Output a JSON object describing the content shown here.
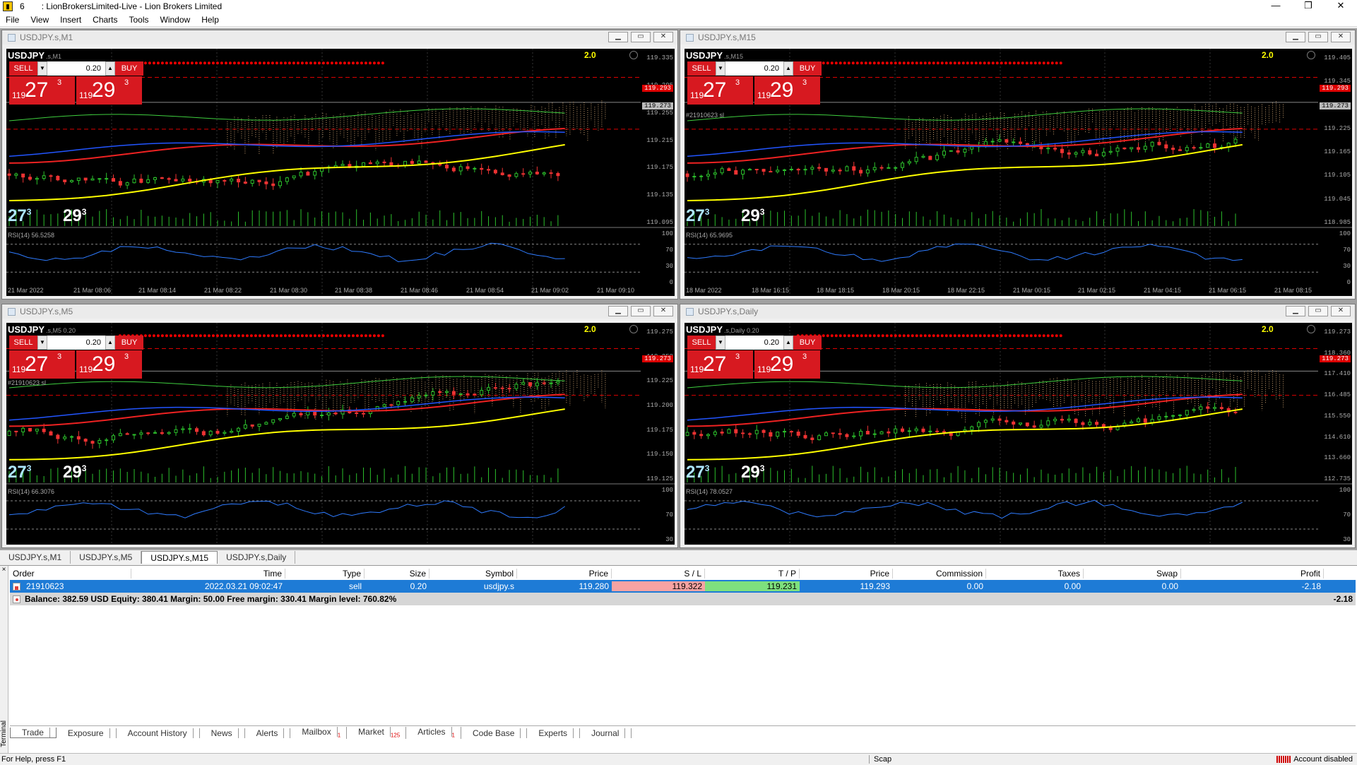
{
  "window": {
    "number": "6",
    "title": ": LionBrokersLimited-Live - Lion Brokers Limited",
    "controls": [
      "—",
      "❐",
      "✕"
    ]
  },
  "menu": [
    "File",
    "View",
    "Insert",
    "Charts",
    "Tools",
    "Window",
    "Help"
  ],
  "charts": [
    {
      "id": "m1",
      "title": "USDJPY.s,M1",
      "symbol": "USDJPY",
      "symbol_suffix": ".s,M1",
      "version": "2.0",
      "sell_label": "SELL",
      "buy_label": "BUY",
      "lot": "0.20",
      "sell_prefix": "119",
      "sell_big": "27",
      "sell_sup": "3",
      "buy_prefix": "119",
      "buy_big": "29",
      "buy_sup": "3",
      "spread_left": "27",
      "spread_left_sup": "3",
      "spread_right": "29",
      "spread_right_sup": "3",
      "price_labels": [
        "119.335",
        "119.295",
        "119.255",
        "119.215",
        "119.175",
        "119.135",
        "119.095"
      ],
      "price_tags": [
        "119.293",
        "119.273"
      ],
      "rsi_label": "RSI(14) 56.5258",
      "rsi_levels": [
        "100",
        "70",
        "30",
        "0"
      ],
      "time_labels": [
        "21 Mar 2022",
        "21 Mar 08:06",
        "21 Mar 08:14",
        "21 Mar 08:22",
        "21 Mar 08:30",
        "21 Mar 08:38",
        "21 Mar 08:46",
        "21 Mar 08:54",
        "21 Mar 09:02",
        "21 Mar 09:10"
      ]
    },
    {
      "id": "m15",
      "title": "USDJPY.s,M15",
      "symbol": "USDJPY",
      "symbol_suffix": ".s,M15",
      "version": "2.0",
      "sell_label": "SELL",
      "buy_label": "BUY",
      "lot": "0.20",
      "sell_prefix": "119",
      "sell_big": "27",
      "sell_sup": "3",
      "buy_prefix": "119",
      "buy_big": "29",
      "buy_sup": "3",
      "spread_left": "27",
      "spread_left_sup": "3",
      "spread_right": "29",
      "spread_right_sup": "3",
      "order_label": "#21910623 sl",
      "price_labels": [
        "119.405",
        "119.345",
        "119.285",
        "119.225",
        "119.165",
        "119.105",
        "119.045",
        "118.985"
      ],
      "price_tags": [
        "119.293",
        "119.273"
      ],
      "rsi_label": "RSI(14) 65.9695",
      "rsi_levels": [
        "100",
        "70",
        "30",
        "0"
      ],
      "time_labels": [
        "18 Mar 2022",
        "18 Mar 16:15",
        "18 Mar 18:15",
        "18 Mar 20:15",
        "18 Mar 22:15",
        "21 Mar 00:15",
        "21 Mar 02:15",
        "21 Mar 04:15",
        "21 Mar 06:15",
        "21 Mar 08:15"
      ]
    },
    {
      "id": "m5",
      "title": "USDJPY.s,M5",
      "symbol": "USDJPY",
      "symbol_suffix": ".s,M5 0.20",
      "version": "2.0",
      "sell_label": "SELL",
      "buy_label": "BUY",
      "lot": "0.20",
      "sell_prefix": "119",
      "sell_big": "27",
      "sell_sup": "3",
      "buy_prefix": "119",
      "buy_big": "29",
      "buy_sup": "3",
      "spread_left": "27",
      "spread_left_sup": "3",
      "spread_right": "29",
      "spread_right_sup": "3",
      "order_label": "#21910623 sl",
      "price_labels": [
        "119.275",
        "119.250",
        "119.225",
        "119.200",
        "119.175",
        "119.150",
        "119.125"
      ],
      "price_tags": [
        "119.273"
      ],
      "rsi_label": "RSI(14) 66.3076",
      "rsi_levels": [
        "100",
        "70",
        "30"
      ],
      "time_labels": []
    },
    {
      "id": "daily",
      "title": "USDJPY.s,Daily",
      "symbol": "USDJPY",
      "symbol_suffix": ".s,Daily 0.20",
      "version": "2.0",
      "sell_label": "SELL",
      "buy_label": "BUY",
      "lot": "0.20",
      "sell_prefix": "119",
      "sell_big": "27",
      "sell_sup": "3",
      "buy_prefix": "119",
      "buy_big": "29",
      "buy_sup": "3",
      "spread_left": "27",
      "spread_left_sup": "3",
      "spread_right": "29",
      "spread_right_sup": "3",
      "price_labels": [
        "119.273",
        "118.360",
        "117.410",
        "116.485",
        "115.550",
        "114.610",
        "113.660",
        "112.735"
      ],
      "price_tags": [
        "119.273"
      ],
      "rsi_label": "RSI(14) 78.0527",
      "rsi_levels": [
        "100",
        "70",
        "30"
      ],
      "time_labels": []
    }
  ],
  "chart_tabs": [
    "USDJPY.s,M1",
    "USDJPY.s,M5",
    "USDJPY.s,M15",
    "USDJPY.s,Daily"
  ],
  "active_chart_tab": "USDJPY.s,M15",
  "terminal": {
    "side_label": "Terminal",
    "close": "×",
    "columns": {
      "order": "Order",
      "time": "Time",
      "type": "Type",
      "size": "Size",
      "symbol": "Symbol",
      "price": "Price",
      "sl": "S / L",
      "tp": "T / P",
      "price2": "Price",
      "commission": "Commission",
      "taxes": "Taxes",
      "swap": "Swap",
      "profit": "Profit"
    },
    "order": {
      "order": "21910623",
      "time": "2022.03.21 09:02:47",
      "type": "sell",
      "size": "0.20",
      "symbol": "usdjpy.s",
      "price": "119.280",
      "sl": "119.322",
      "tp": "119.231",
      "price2": "119.293",
      "commission": "0.00",
      "taxes": "0.00",
      "swap": "0.00",
      "profit": "-2.18"
    },
    "balance_line": "Balance: 382.59 USD  Equity: 380.41  Margin: 50.00  Free margin: 330.41  Margin level: 760.82%",
    "balance_profit": "-2.18",
    "tabs": [
      {
        "label": "Trade",
        "badge": ""
      },
      {
        "label": "Exposure",
        "badge": ""
      },
      {
        "label": "Account History",
        "badge": ""
      },
      {
        "label": "News",
        "badge": ""
      },
      {
        "label": "Alerts",
        "badge": ""
      },
      {
        "label": "Mailbox",
        "badge": "1"
      },
      {
        "label": "Market",
        "badge": "125"
      },
      {
        "label": "Articles",
        "badge": "1"
      },
      {
        "label": "Code Base",
        "badge": ""
      },
      {
        "label": "Experts",
        "badge": ""
      },
      {
        "label": "Journal",
        "badge": ""
      }
    ]
  },
  "status": {
    "help": "For Help, press F1",
    "mode": "Scap",
    "account": "Account disabled"
  }
}
